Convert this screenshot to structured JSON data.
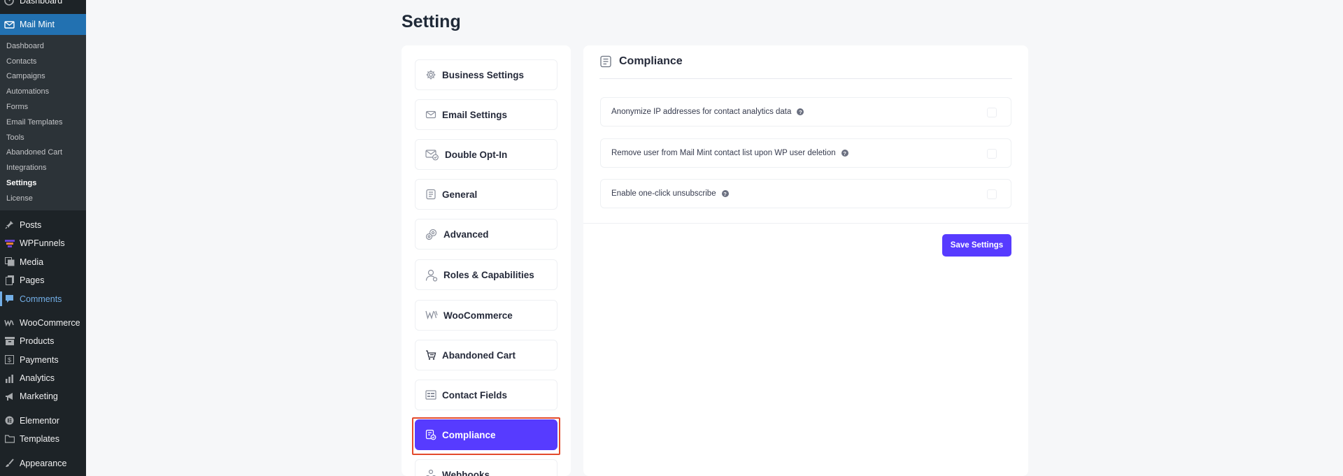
{
  "admin_menu": {
    "top_label": "Dashboard",
    "plugin": {
      "label": "Mail Mint"
    },
    "submenu": [
      {
        "label": "Dashboard"
      },
      {
        "label": "Contacts"
      },
      {
        "label": "Campaigns"
      },
      {
        "label": "Automations"
      },
      {
        "label": "Forms"
      },
      {
        "label": "Email Templates"
      },
      {
        "label": "Tools"
      },
      {
        "label": "Abandoned Cart"
      },
      {
        "label": "Integrations"
      },
      {
        "label": "Settings"
      },
      {
        "label": "License"
      }
    ],
    "items": [
      {
        "label": "Posts"
      },
      {
        "label": "WPFunnels"
      },
      {
        "label": "Media"
      },
      {
        "label": "Pages"
      },
      {
        "label": "Comments"
      },
      {
        "label": "WooCommerce"
      },
      {
        "label": "Products"
      },
      {
        "label": "Payments"
      },
      {
        "label": "Analytics"
      },
      {
        "label": "Marketing"
      },
      {
        "label": "Elementor"
      },
      {
        "label": "Templates"
      },
      {
        "label": "Appearance"
      }
    ],
    "highlight_color": "#72aee6",
    "active_bg": "#2271b1"
  },
  "page": {
    "title": "Setting"
  },
  "settings_nav": {
    "items": [
      {
        "label": "Business Settings",
        "icon": "gear-icon"
      },
      {
        "label": "Email Settings",
        "icon": "envelope-icon"
      },
      {
        "label": "Double Opt-In",
        "icon": "envelope-check-icon"
      },
      {
        "label": "General",
        "icon": "document-icon"
      },
      {
        "label": "Advanced",
        "icon": "gears-icon"
      },
      {
        "label": "Roles & Capabilities",
        "icon": "user-icon"
      },
      {
        "label": "WooCommerce",
        "icon": "woo-icon"
      },
      {
        "label": "Abandoned Cart",
        "icon": "cart-icon"
      },
      {
        "label": "Contact Fields",
        "icon": "fields-icon"
      },
      {
        "label": "Compliance",
        "icon": "compliance-icon",
        "active": true
      },
      {
        "label": "Webhooks",
        "icon": "webhook-icon"
      }
    ],
    "accent": "#573bff"
  },
  "compliance": {
    "title": "Compliance",
    "options": [
      {
        "label": "Anonymize IP addresses for contact analytics data",
        "checked": false
      },
      {
        "label": "Remove user from Mail Mint contact list upon WP user deletion",
        "checked": false
      },
      {
        "label": "Enable one-click unsubscribe",
        "checked": false
      }
    ],
    "help_glyph": "?",
    "save_label": "Save Settings"
  }
}
